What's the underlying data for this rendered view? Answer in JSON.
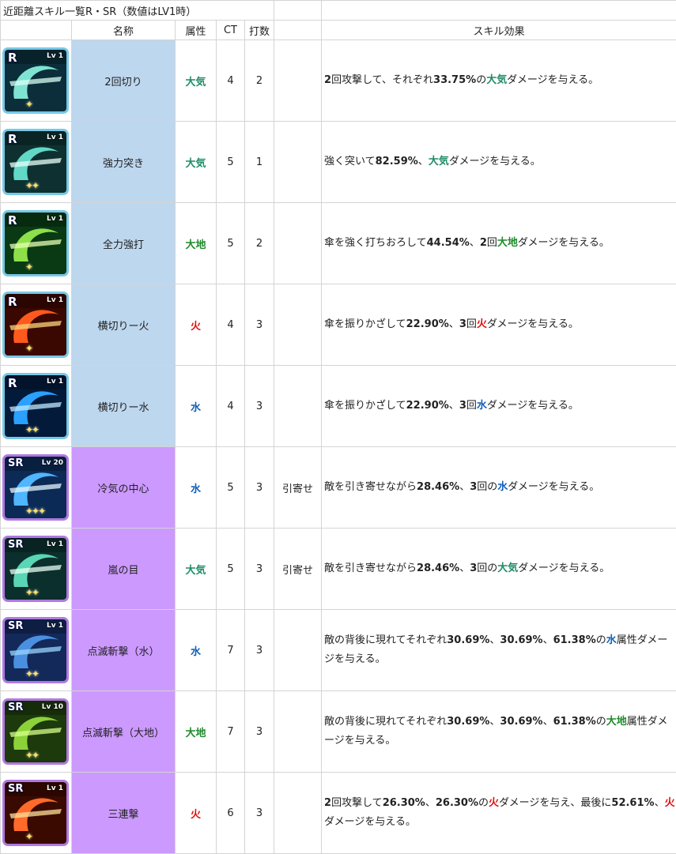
{
  "title": "近距離スキル一覧R・SR（数値はLV1時）",
  "headers": {
    "name": "名称",
    "attribute": "属性",
    "ct": "CT",
    "hits": "打数",
    "note": "",
    "effect": "スキル効果"
  },
  "colors": {
    "r_group": "#bdd7ee",
    "sr_group": "#cc99ff",
    "wind": "#1e8c66",
    "earth": "#1f8a2c",
    "fire": "#e01010",
    "water": "#1060b8"
  },
  "skills": [
    {
      "rank": "R",
      "level": "Lv 1",
      "stars": "✦",
      "icon": "wind-slash-icon",
      "name": "2回切り",
      "attribute": "大気",
      "ct": "4",
      "hits": "2",
      "note": "",
      "effect": [
        {
          "t": "2",
          "b": true
        },
        {
          "t": "回攻撃して、それぞれ"
        },
        {
          "t": "33.75%",
          "b": true
        },
        {
          "t": "の"
        },
        {
          "t": "大気",
          "b": true,
          "c": "wind"
        },
        {
          "t": "ダメージを与える。"
        }
      ]
    },
    {
      "rank": "R",
      "level": "Lv 1",
      "stars": "✦✦",
      "icon": "thrust-icon",
      "name": "強力突き",
      "attribute": "大気",
      "ct": "5",
      "hits": "1",
      "note": "",
      "effect": [
        {
          "t": "強く突いて"
        },
        {
          "t": "82.59%",
          "b": true
        },
        {
          "t": "、"
        },
        {
          "t": "大気",
          "b": true,
          "c": "wind"
        },
        {
          "t": "ダメージを与える。"
        }
      ]
    },
    {
      "rank": "R",
      "level": "Lv 1",
      "stars": "✦",
      "icon": "earth-swirl-icon",
      "name": "全力強打",
      "attribute": "大地",
      "ct": "5",
      "hits": "2",
      "note": "",
      "effect": [
        {
          "t": "傘を強く打ちおろして"
        },
        {
          "t": "44.54%",
          "b": true
        },
        {
          "t": "、"
        },
        {
          "t": "2",
          "b": true
        },
        {
          "t": "回"
        },
        {
          "t": "大地",
          "b": true,
          "c": "earth"
        },
        {
          "t": "ダメージを与える。"
        }
      ]
    },
    {
      "rank": "R",
      "level": "Lv 1",
      "stars": "✦",
      "icon": "fire-swirl-icon",
      "name": "横切りー火",
      "attribute": "火",
      "ct": "4",
      "hits": "3",
      "note": "",
      "effect": [
        {
          "t": "傘を振りかざして"
        },
        {
          "t": "22.90%",
          "b": true
        },
        {
          "t": "、"
        },
        {
          "t": "3",
          "b": true
        },
        {
          "t": "回"
        },
        {
          "t": "火",
          "b": true,
          "c": "fire"
        },
        {
          "t": "ダメージを与える。"
        }
      ]
    },
    {
      "rank": "R",
      "level": "Lv 1",
      "stars": "✦✦",
      "icon": "water-swirl-icon",
      "name": "横切りー水",
      "attribute": "水",
      "ct": "4",
      "hits": "3",
      "note": "",
      "effect": [
        {
          "t": "傘を振りかざして"
        },
        {
          "t": "22.90%",
          "b": true
        },
        {
          "t": "、"
        },
        {
          "t": "3",
          "b": true
        },
        {
          "t": "回"
        },
        {
          "t": "水",
          "b": true,
          "c": "water"
        },
        {
          "t": "ダメージを与える。"
        }
      ]
    },
    {
      "rank": "SR",
      "level": "Lv 20",
      "stars": "✦✦✦",
      "icon": "cold-pull-icon",
      "name": "冷気の中心",
      "attribute": "水",
      "ct": "5",
      "hits": "3",
      "note": "引寄せ",
      "effect": [
        {
          "t": "敵を引き寄せながら"
        },
        {
          "t": "28.46%",
          "b": true
        },
        {
          "t": "、"
        },
        {
          "t": "3",
          "b": true
        },
        {
          "t": "回の"
        },
        {
          "t": "水",
          "b": true,
          "c": "water"
        },
        {
          "t": "ダメージを与える。"
        }
      ]
    },
    {
      "rank": "SR",
      "level": "Lv 1",
      "stars": "✦✦",
      "icon": "storm-eye-icon",
      "name": "嵐の目",
      "attribute": "大気",
      "ct": "5",
      "hits": "3",
      "note": "引寄せ",
      "effect": [
        {
          "t": "敵を引き寄せながら"
        },
        {
          "t": "28.46%",
          "b": true
        },
        {
          "t": "、"
        },
        {
          "t": "3",
          "b": true
        },
        {
          "t": "回の"
        },
        {
          "t": "大気",
          "b": true,
          "c": "wind"
        },
        {
          "t": "ダメージを与える。"
        }
      ]
    },
    {
      "rank": "SR",
      "level": "Lv 1",
      "stars": "✦✦",
      "icon": "blink-slash-water-icon",
      "name": "点滅斬撃（水）",
      "attribute": "水",
      "ct": "7",
      "hits": "3",
      "note": "",
      "effect": [
        {
          "t": "敵の背後に現れてそれぞれ"
        },
        {
          "t": "30.69%",
          "b": true
        },
        {
          "t": "、"
        },
        {
          "t": "30.69%",
          "b": true
        },
        {
          "t": "、"
        },
        {
          "t": "61.38%",
          "b": true
        },
        {
          "t": "の"
        },
        {
          "t": "水",
          "b": true,
          "c": "water"
        },
        {
          "t": "属性ダメージを与える。"
        }
      ]
    },
    {
      "rank": "SR",
      "level": "Lv 10",
      "stars": "✦✦",
      "icon": "blink-slash-earth-icon",
      "name": "点滅斬撃（大地）",
      "attribute": "大地",
      "ct": "7",
      "hits": "3",
      "note": "",
      "effect": [
        {
          "t": "敵の背後に現れてそれぞれ"
        },
        {
          "t": "30.69%",
          "b": true
        },
        {
          "t": "、"
        },
        {
          "t": "30.69%",
          "b": true
        },
        {
          "t": "、"
        },
        {
          "t": "61.38%",
          "b": true
        },
        {
          "t": "の"
        },
        {
          "t": "大地",
          "b": true,
          "c": "earth"
        },
        {
          "t": "属性ダメージを与える。"
        }
      ]
    },
    {
      "rank": "SR",
      "level": "Lv 1",
      "stars": "✦",
      "icon": "triple-strike-icon",
      "name": "三連撃",
      "attribute": "火",
      "ct": "6",
      "hits": "3",
      "note": "",
      "effect": [
        {
          "t": "2",
          "b": true
        },
        {
          "t": "回攻撃して"
        },
        {
          "t": "26.30%",
          "b": true
        },
        {
          "t": "、"
        },
        {
          "t": "26.30%",
          "b": true
        },
        {
          "t": "の"
        },
        {
          "t": "火",
          "b": true,
          "c": "fire"
        },
        {
          "t": "ダメージを与え、最後に"
        },
        {
          "t": "52.61%",
          "b": true
        },
        {
          "t": "、"
        },
        {
          "t": "火",
          "b": true,
          "c": "fire"
        },
        {
          "t": "ダメージを与える。"
        }
      ]
    }
  ]
}
